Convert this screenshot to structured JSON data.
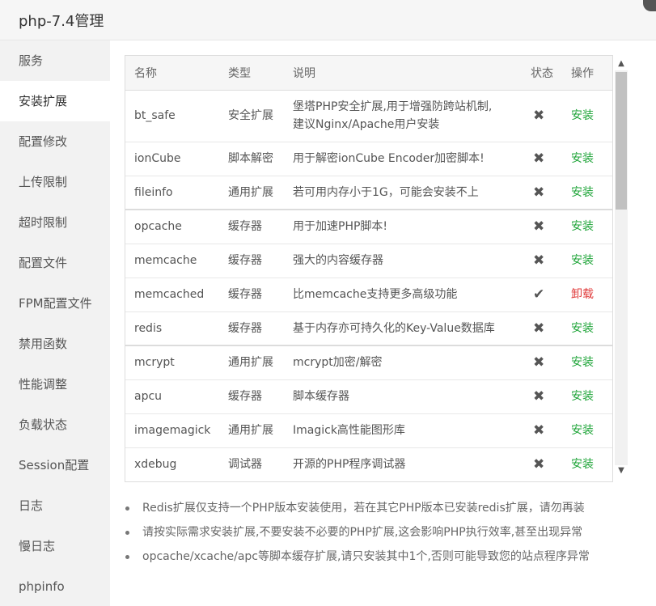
{
  "window": {
    "title": "php-7.4管理"
  },
  "sidebar": {
    "items": [
      {
        "label": "服务",
        "name": "sidebar-item-service"
      },
      {
        "label": "安装扩展",
        "name": "sidebar-item-extensions"
      },
      {
        "label": "配置修改",
        "name": "sidebar-item-config-edit"
      },
      {
        "label": "上传限制",
        "name": "sidebar-item-upload-limit"
      },
      {
        "label": "超时限制",
        "name": "sidebar-item-timeout-limit"
      },
      {
        "label": "配置文件",
        "name": "sidebar-item-config-file"
      },
      {
        "label": "FPM配置文件",
        "name": "sidebar-item-fpm-config"
      },
      {
        "label": "禁用函数",
        "name": "sidebar-item-disabled-functions"
      },
      {
        "label": "性能调整",
        "name": "sidebar-item-performance"
      },
      {
        "label": "负载状态",
        "name": "sidebar-item-load-status"
      },
      {
        "label": "Session配置",
        "name": "sidebar-item-session-config"
      },
      {
        "label": "日志",
        "name": "sidebar-item-log"
      },
      {
        "label": "慢日志",
        "name": "sidebar-item-slow-log"
      },
      {
        "label": "phpinfo",
        "name": "sidebar-item-phpinfo"
      }
    ],
    "active_index": 1
  },
  "table": {
    "headers": {
      "name": "名称",
      "type": "类型",
      "desc": "说明",
      "status": "状态",
      "op": "操作"
    },
    "rows": [
      {
        "name": "bt_safe",
        "type": "安全扩展",
        "desc": [
          "堡塔PHP安全扩展,用于增强防跨站机制,",
          "建议Nginx/Apache用户安装"
        ],
        "installed": false,
        "action": "安装"
      },
      {
        "name": "ionCube",
        "type": "脚本解密",
        "desc": [
          "用于解密ionCube Encoder加密脚本!"
        ],
        "installed": false,
        "action": "安装"
      },
      {
        "name": "fileinfo",
        "type": "通用扩展",
        "desc": [
          "若可用内存小于1G，可能会安装不上"
        ],
        "installed": false,
        "action": "安装"
      },
      {
        "name": "opcache",
        "type": "缓存器",
        "desc": [
          "用于加速PHP脚本!"
        ],
        "installed": false,
        "action": "安装"
      },
      {
        "name": "memcache",
        "type": "缓存器",
        "desc": [
          "强大的内容缓存器"
        ],
        "installed": false,
        "action": "安装"
      },
      {
        "name": "memcached",
        "type": "缓存器",
        "desc": [
          "比memcache支持更多高级功能"
        ],
        "installed": true,
        "action": "卸载"
      },
      {
        "name": "redis",
        "type": "缓存器",
        "desc": [
          "基于内存亦可持久化的Key-Value数据库"
        ],
        "installed": false,
        "action": "安装"
      },
      {
        "name": "mcrypt",
        "type": "通用扩展",
        "desc": [
          "mcrypt加密/解密"
        ],
        "installed": false,
        "action": "安装"
      },
      {
        "name": "apcu",
        "type": "缓存器",
        "desc": [
          "脚本缓存器"
        ],
        "installed": false,
        "action": "安装"
      },
      {
        "name": "imagemagick",
        "type": "通用扩展",
        "desc": [
          "Imagick高性能图形库"
        ],
        "installed": false,
        "action": "安装"
      },
      {
        "name": "xdebug",
        "type": "调试器",
        "desc": [
          "开源的PHP程序调试器"
        ],
        "installed": false,
        "action": "安装"
      }
    ]
  },
  "icons": {
    "installed": "check-icon",
    "not_installed": "cross-icon"
  },
  "colors": {
    "install": "#20a53a",
    "uninstall": "#e03b3b",
    "sidebar_bg": "#f2f2f2"
  },
  "notes": [
    "Redis扩展仅支持一个PHP版本安装使用，若在其它PHP版本已安装redis扩展，请勿再装",
    "请按实际需求安装扩展,不要安装不必要的PHP扩展,这会影响PHP执行效率,甚至出现异常",
    "opcache/xcache/apc等脚本缓存扩展,请只安装其中1个,否则可能导致您的站点程序异常"
  ]
}
